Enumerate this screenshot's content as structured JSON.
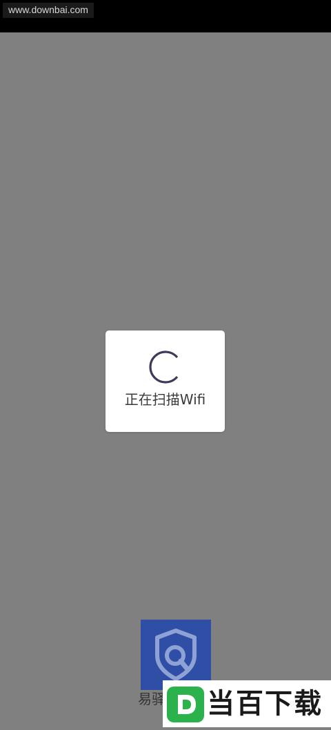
{
  "status_bar": {
    "watermark_url": "www.downbai.com"
  },
  "dialog": {
    "icon": "spinner-icon",
    "message": "正在扫描Wifi"
  },
  "splash": {
    "logo_icon": "shield-search-icon",
    "app_name": "易驿",
    "logo_color": "#2f4ea6"
  },
  "download_badge": {
    "icon": "d-logo-icon",
    "text": "当百下载",
    "accent_color": "#2bb24c"
  },
  "colors": {
    "overlay": "#808080",
    "status_bar": "#000000",
    "dialog_bg": "#ffffff",
    "spinner": "#3c3c5a"
  }
}
